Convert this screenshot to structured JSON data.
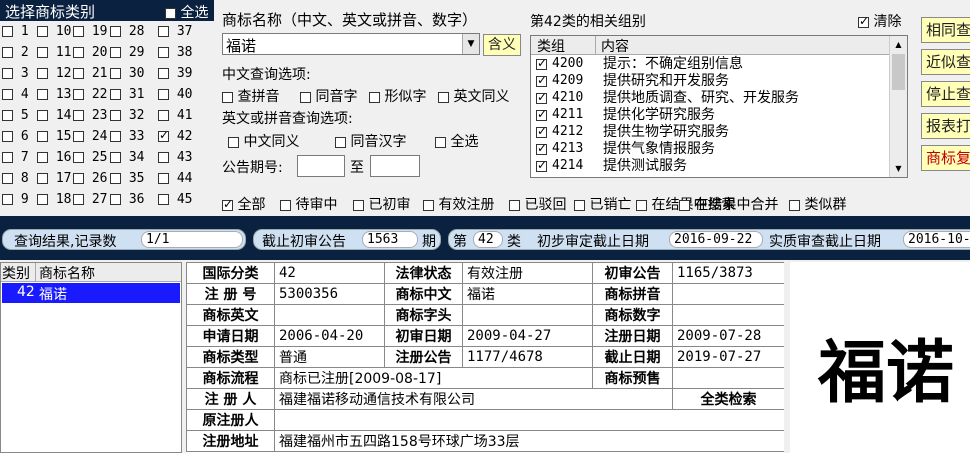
{
  "categories": {
    "title": "选择商标类别",
    "select_all": "全选",
    "columns": [
      [
        {
          "n": "1",
          "c": false
        },
        {
          "n": "2",
          "c": false
        },
        {
          "n": "3",
          "c": false
        },
        {
          "n": "4",
          "c": false
        },
        {
          "n": "5",
          "c": false
        },
        {
          "n": "6",
          "c": false
        },
        {
          "n": "7",
          "c": false
        },
        {
          "n": "8",
          "c": false
        },
        {
          "n": "9",
          "c": false
        }
      ],
      [
        {
          "n": "10",
          "c": false
        },
        {
          "n": "11",
          "c": false
        },
        {
          "n": "12",
          "c": false
        },
        {
          "n": "13",
          "c": false
        },
        {
          "n": "14",
          "c": false
        },
        {
          "n": "15",
          "c": false
        },
        {
          "n": "16",
          "c": false
        },
        {
          "n": "17",
          "c": false
        },
        {
          "n": "18",
          "c": false
        }
      ],
      [
        {
          "n": "19",
          "c": false
        },
        {
          "n": "20",
          "c": false
        },
        {
          "n": "21",
          "c": false
        },
        {
          "n": "22",
          "c": false
        },
        {
          "n": "23",
          "c": false
        },
        {
          "n": "24",
          "c": false
        },
        {
          "n": "25",
          "c": false
        },
        {
          "n": "26",
          "c": false
        },
        {
          "n": "27",
          "c": false
        }
      ],
      [
        {
          "n": "28",
          "c": false
        },
        {
          "n": "29",
          "c": false
        },
        {
          "n": "30",
          "c": false
        },
        {
          "n": "31",
          "c": false
        },
        {
          "n": "32",
          "c": false
        },
        {
          "n": "33",
          "c": false
        },
        {
          "n": "34",
          "c": false
        },
        {
          "n": "35",
          "c": false
        },
        {
          "n": "36",
          "c": false
        }
      ],
      [
        {
          "n": "37",
          "c": false
        },
        {
          "n": "38",
          "c": false
        },
        {
          "n": "39",
          "c": false
        },
        {
          "n": "40",
          "c": false
        },
        {
          "n": "41",
          "c": false
        },
        {
          "n": "42",
          "c": true
        },
        {
          "n": "43",
          "c": false
        },
        {
          "n": "44",
          "c": false
        },
        {
          "n": "45",
          "c": false
        }
      ]
    ]
  },
  "search": {
    "label": "商标名称（中文、英文或拼音、数字）",
    "value": "福诺",
    "contains_btn": "含义",
    "cn_options_label": "中文查询选项:",
    "cn_options": [
      "查拼音",
      "同音字",
      "形似字",
      "英文同义"
    ],
    "en_options_label": "英文或拼音查询选项:",
    "en_options": [
      "中文同义",
      "同音汉字",
      "全选"
    ],
    "pub_label": "公告期号:",
    "to_label": "至"
  },
  "groups": {
    "title": "第42类的相关组别",
    "clear_label": "清除",
    "col_group": "类组",
    "col_content": "内容",
    "rows": [
      {
        "code": "4200",
        "text": "提示：不确定组别信息"
      },
      {
        "code": "4209",
        "text": "提供研究和开发服务"
      },
      {
        "code": "4210",
        "text": "提供地质调查、研究、开发服务"
      },
      {
        "code": "4211",
        "text": "提供化学研究服务"
      },
      {
        "code": "4212",
        "text": "提供生物学研究服务"
      },
      {
        "code": "4213",
        "text": "提供气象情报服务"
      },
      {
        "code": "4214",
        "text": "提供测试服务"
      }
    ]
  },
  "right_buttons": [
    "相同查",
    "近似查",
    "停止查",
    "报表打",
    "商标复"
  ],
  "status_filters": [
    {
      "label": "全部",
      "c": true
    },
    {
      "label": "待审中",
      "c": false
    },
    {
      "label": "已初审",
      "c": false
    },
    {
      "label": "有效注册",
      "c": false
    },
    {
      "label": "已驳回",
      "c": false
    },
    {
      "label": "已销亡",
      "c": false
    },
    {
      "label": "在结果中搜索",
      "c": false
    },
    {
      "label": "在结果中合并",
      "c": false
    },
    {
      "label": "类似群",
      "c": false
    }
  ],
  "infobar": {
    "result_label": "查询结果,记录数",
    "result_value": "1/1",
    "deadline_label": "截止初审公告",
    "deadline_value": "1563",
    "deadline_unit": "期",
    "class_prefix": "第",
    "class_value": "42",
    "class_suffix": "类",
    "prelim_label": "初步审定截止日期",
    "prelim_value": "2016-09-22",
    "exam_label": "实质审查截止日期",
    "exam_value": "2016-10-"
  },
  "result_list": {
    "col_class": "类别",
    "col_name": "商标名称",
    "rows": [
      {
        "class": "42",
        "name": "福诺"
      }
    ]
  },
  "detail": {
    "intl_class_label": "国际分类",
    "intl_class": "42",
    "legal_status_label": "法律状态",
    "legal_status": "有效注册",
    "prelim_pub_label": "初审公告",
    "prelim_pub": "1165/3873",
    "reg_no_label": "注 册 号",
    "reg_no": "5300356",
    "cn_label": "商标中文",
    "cn": "福诺",
    "pinyin_label": "商标拼音",
    "pinyin": "",
    "en_label": "商标英文",
    "en": "",
    "head_label": "商标字头",
    "head": "",
    "num_label": "商标数字",
    "num": "",
    "apply_label": "申请日期",
    "apply": "2006-04-20",
    "prelim_date_label": "初审日期",
    "prelim_date": "2009-04-27",
    "reg_date_label": "注册日期",
    "reg_date": "2009-07-28",
    "type_label": "商标类型",
    "type": "普通",
    "reg_pub_label": "注册公告",
    "reg_pub": "1177/4678",
    "expiry_label": "截止日期",
    "expiry": "2019-07-27",
    "flow_label": "商标流程",
    "flow": "商标已注册[2009-08-17]",
    "notice_label": "商标预售",
    "notice": "",
    "registrant_label": "注 册 人",
    "registrant": "福建福诺移动通信技术有限公司",
    "all_class_search": "全类检索",
    "orig_registrant_label": "原注册人",
    "orig_registrant": "",
    "address_label": "注册地址",
    "address": "福建福州市五四路158号环球广场33层"
  },
  "preview": {
    "text": "福诺"
  }
}
